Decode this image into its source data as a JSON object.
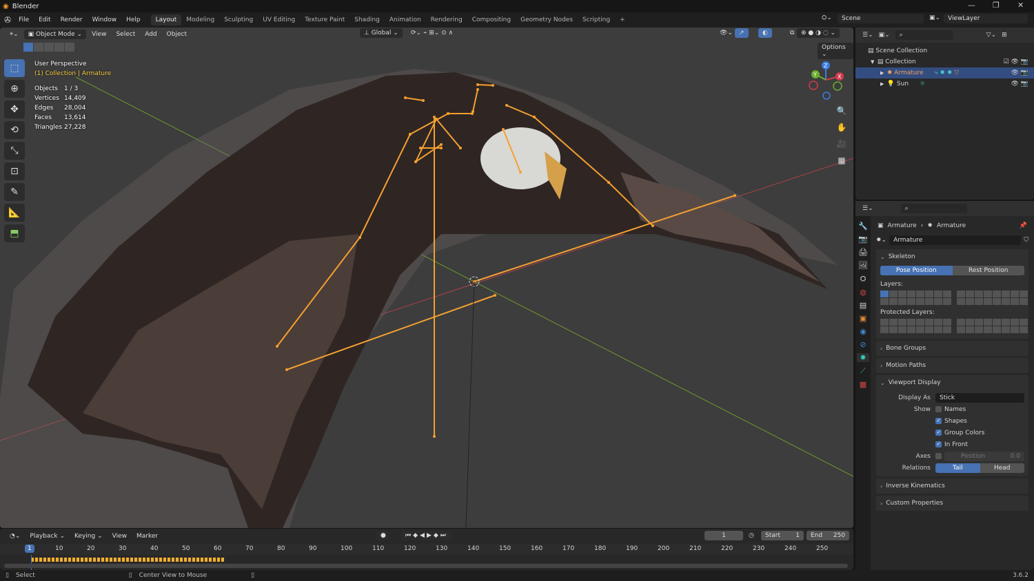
{
  "app": {
    "title": "Blender",
    "version": "3.6.2"
  },
  "menu": [
    "File",
    "Edit",
    "Render",
    "Window",
    "Help"
  ],
  "workspaces": [
    "Layout",
    "Modeling",
    "Sculpting",
    "UV Editing",
    "Texture Paint",
    "Shading",
    "Animation",
    "Rendering",
    "Compositing",
    "Geometry Nodes",
    "Scripting"
  ],
  "active_workspace": "Layout",
  "scene": {
    "name": "Scene",
    "view_layer": "ViewLayer"
  },
  "viewport": {
    "mode": "Object Mode",
    "menus": [
      "View",
      "Select",
      "Add",
      "Object"
    ],
    "orientation": "Global",
    "options_label": "Options",
    "perspective": "User Perspective",
    "context": "(1) Collection | Armature",
    "stats": [
      {
        "k": "Objects",
        "v": "1 / 3"
      },
      {
        "k": "Vertices",
        "v": "14,409"
      },
      {
        "k": "Edges",
        "v": "28,004"
      },
      {
        "k": "Faces",
        "v": "13,614"
      },
      {
        "k": "Triangles",
        "v": "27,228"
      }
    ],
    "gizmo": {
      "x": "X",
      "y": "Y",
      "z": "Z"
    },
    "colors": {
      "bone": "#f5a030",
      "bg": "#3d3d3d",
      "x_axis": "#b0404a",
      "y_axis": "#6d9a2e"
    }
  },
  "outliner": {
    "items": [
      {
        "label": "Scene Collection"
      },
      {
        "label": "Collection"
      },
      {
        "label": "Armature",
        "selected": true
      },
      {
        "label": "Sun"
      }
    ]
  },
  "properties": {
    "breadcrumb": [
      "Armature",
      "Armature"
    ],
    "data_name": "Armature",
    "skeleton": {
      "title": "Skeleton",
      "pose": "Pose Position",
      "rest": "Rest Position",
      "active": "Pose Position",
      "layers_label": "Layers:",
      "protected_label": "Protected Layers:"
    },
    "collapsed_top": [
      "Bone Groups",
      "Motion Paths"
    ],
    "viewport_display": {
      "title": "Viewport Display",
      "display_as_label": "Display As",
      "display_as": "Stick",
      "show_label": "Show",
      "show": [
        {
          "label": "Names",
          "checked": false
        },
        {
          "label": "Shapes",
          "checked": true
        },
        {
          "label": "Group Colors",
          "checked": true
        },
        {
          "label": "In Front",
          "checked": true
        }
      ],
      "axes_label": "Axes",
      "axes_position_label": "Position",
      "axes_position": "0.0",
      "relations_label": "Relations",
      "tail": "Tail",
      "head": "Head",
      "relations_active": "Tail"
    },
    "collapsed_bottom": [
      "Inverse Kinematics",
      "Custom Properties"
    ]
  },
  "timeline": {
    "menus": [
      "Playback",
      "Keying",
      "View",
      "Marker"
    ],
    "current_frame": "1",
    "start_label": "Start",
    "start": "1",
    "end_label": "End",
    "end": "250",
    "ticks": [
      "10",
      "20",
      "30",
      "40",
      "50",
      "60",
      "70",
      "80",
      "90",
      "100",
      "110",
      "120",
      "130",
      "140",
      "150",
      "160",
      "170",
      "180",
      "190",
      "200",
      "210",
      "220",
      "230",
      "240",
      "250"
    ]
  },
  "status": {
    "select": "Select",
    "center": "Center View to Mouse"
  }
}
